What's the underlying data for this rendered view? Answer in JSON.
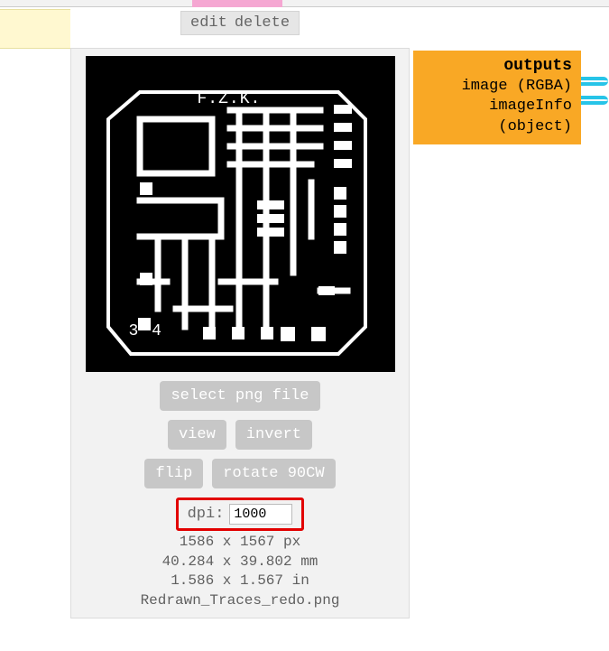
{
  "toolbar": {
    "edit_label": "edit",
    "delete_label": "delete"
  },
  "pcb": {
    "label_fzk": "F.Z.K.",
    "label_34": "3 4"
  },
  "buttons": {
    "select_png": "select png file",
    "view": "view",
    "invert": "invert",
    "flip": "flip",
    "rotate": "rotate 90CW"
  },
  "dpi": {
    "label": "dpi:",
    "value": "1000"
  },
  "info": {
    "px": "1586 x 1567 px",
    "mm": "40.284 x 39.802 mm",
    "in": "1.586 x 1.567 in",
    "filename": "Redrawn_Traces_redo.png"
  },
  "outputs": {
    "title": "outputs",
    "line1": "image (RGBA)",
    "line2": "imageInfo (object)"
  }
}
